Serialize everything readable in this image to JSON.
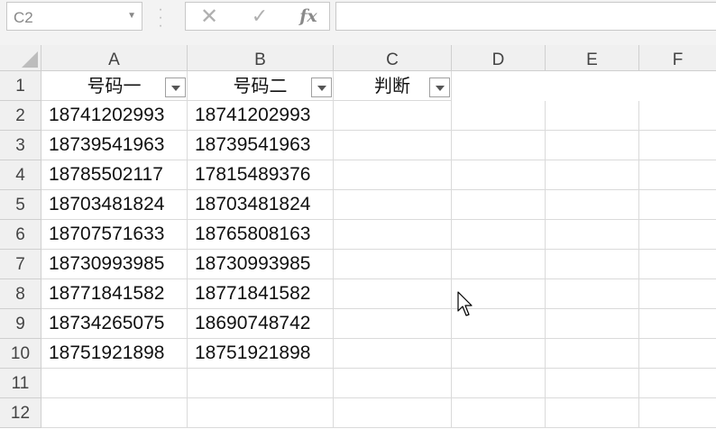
{
  "name_box": {
    "value": "C2"
  },
  "formula_bar": {
    "cancel_icon": "close-icon",
    "enter_icon": "checkmark-icon",
    "fx_label": "fx",
    "value": ""
  },
  "columns": [
    "A",
    "B",
    "C",
    "D",
    "E",
    "F"
  ],
  "rows": [
    "1",
    "2",
    "3",
    "4",
    "5",
    "6",
    "7",
    "8",
    "9",
    "10",
    "11",
    "12"
  ],
  "table": {
    "headers": [
      "号码一",
      "号码二",
      "判断"
    ],
    "data": [
      [
        "18741202993",
        "18741202993"
      ],
      [
        "18739541963",
        "18739541963"
      ],
      [
        "18785502117",
        "17815489376"
      ],
      [
        "18703481824",
        "18703481824"
      ],
      [
        "18707571633",
        "18765808163"
      ],
      [
        "18730993985",
        "18730993985"
      ],
      [
        "18771841582",
        "18771841582"
      ],
      [
        "18734265075",
        "18690748742"
      ],
      [
        "18751921898",
        "18751921898"
      ]
    ]
  },
  "colors": {
    "header_bg": "#f0f0f0",
    "grid_line": "#dadada",
    "text": "#111111"
  }
}
